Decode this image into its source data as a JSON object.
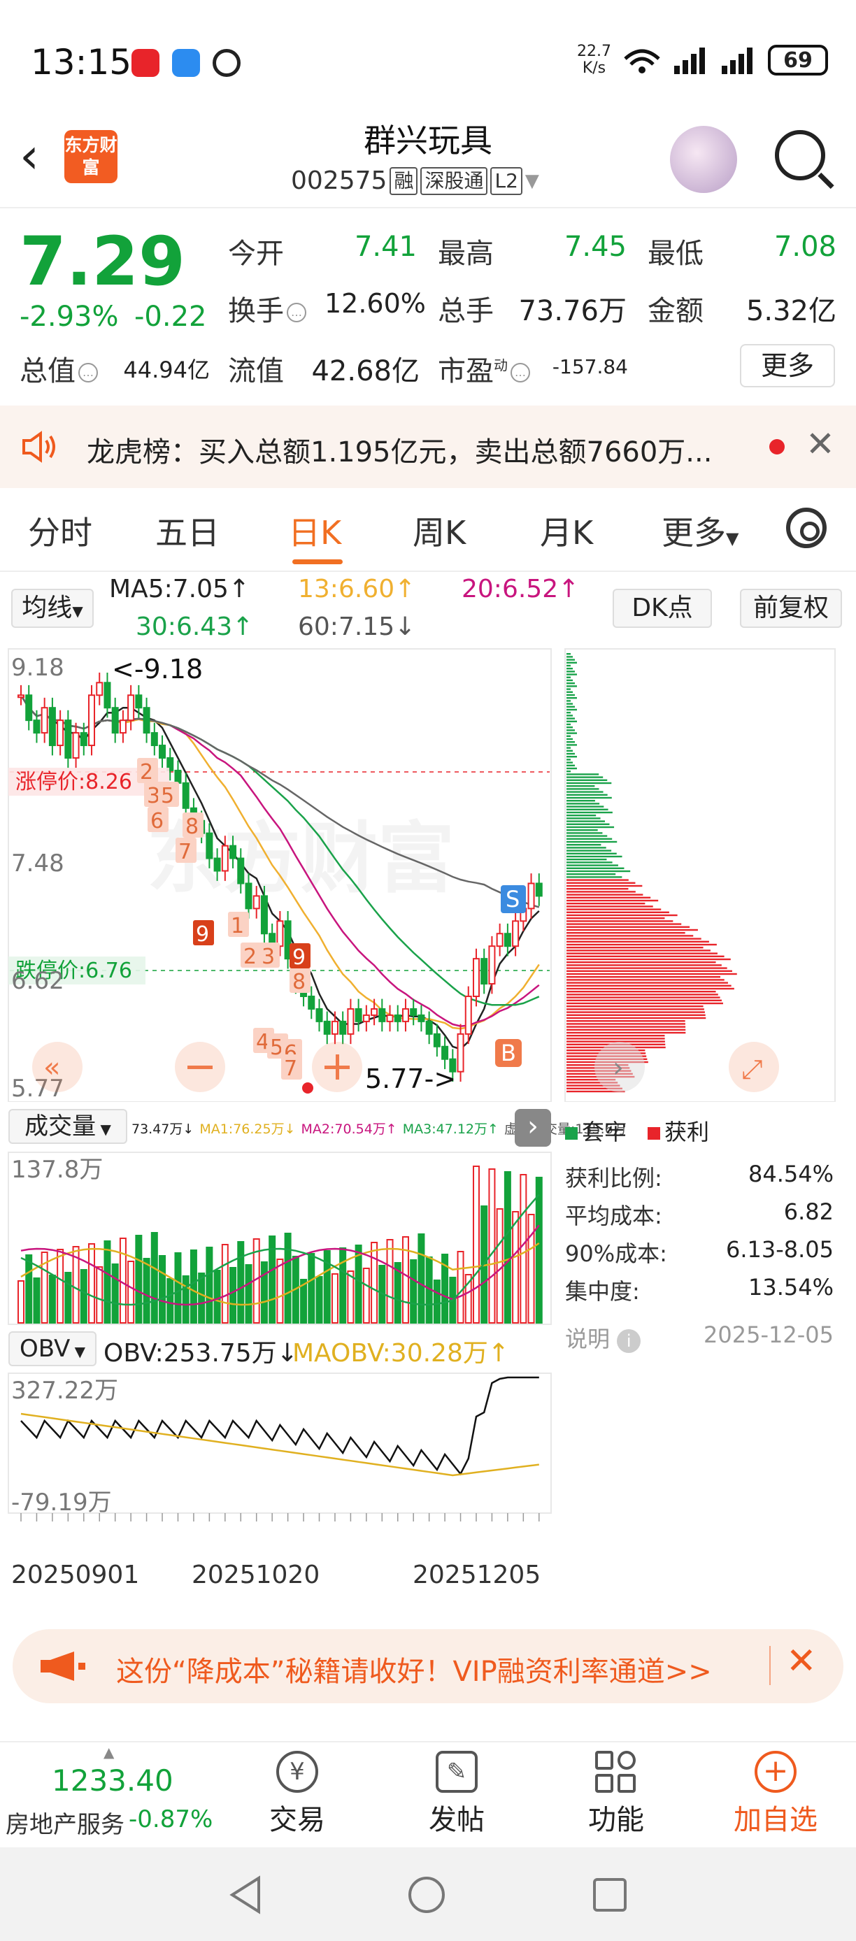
{
  "status_bar": {
    "time": "13:15",
    "net_speed": "22.7",
    "net_unit": "K/s",
    "battery": "69"
  },
  "header": {
    "logo_text": "东方财富",
    "stock_name": "群兴玩具",
    "stock_code": "002575",
    "tag_margin": "融",
    "tag_connect": "深股通",
    "tag_level": "L2"
  },
  "quote": {
    "price": "7.29",
    "change_pct": "-2.93%",
    "change_abs": "-0.22",
    "open_label": "今开",
    "open": "7.41",
    "high_label": "最高",
    "high": "7.45",
    "low_label": "最低",
    "low": "7.08",
    "turnover_label": "换手",
    "turnover": "12.60%",
    "volume_label": "总手",
    "volume": "73.76万",
    "amount_label": "金额",
    "amount": "5.32亿",
    "total_mv_label": "总值",
    "total_mv": "44.94亿",
    "float_mv_label": "流值",
    "float_mv": "42.68亿",
    "pe_label": "市盈",
    "pe_sup": "动",
    "pe": "-157.84",
    "more_label": "更多"
  },
  "lhb": {
    "text": "龙虎榜：买入总额1.195亿元，卖出总额7660万..."
  },
  "tabs": [
    "分时",
    "五日",
    "日K",
    "周K",
    "月K",
    "更多"
  ],
  "active_tab": "日K",
  "indicators": {
    "ma_selector": "均线",
    "ma5": "MA5:7.05↑",
    "ma13": "13:6.60↑",
    "ma20": "20:6.52↑",
    "ma30": "30:6.43↑",
    "ma60": "60:7.15↓",
    "dk_label": "DK点",
    "fq_label": "前复权"
  },
  "kline": {
    "price_top": "9.18",
    "price_mid": "7.48",
    "price_low_axis": "6.62",
    "price_bottom": "5.77",
    "high_mark": "<-9.18",
    "low_mark": "5.77->",
    "limit_up": "涨停价:8.26",
    "limit_down": "跌停价:6.76",
    "sign_s": "S",
    "sign_b": "B",
    "td_marks": [
      "2",
      "3",
      "5",
      "6",
      "8",
      "7",
      "9",
      "1",
      "2",
      "3",
      "8",
      "9",
      "4",
      "5",
      "6",
      "7"
    ],
    "colors": {
      "ma5": "#222222",
      "ma13": "#f0b030",
      "ma20": "#c8157e",
      "ma30": "#1aa24a",
      "ma60": "#666666",
      "up": "#e8242a",
      "down": "#12a23a"
    }
  },
  "volume": {
    "selector": "成交量",
    "legend": [
      "73.47万↓",
      "MA1:76.25万↓",
      "MA2:70.54万↑",
      "MA3:47.12万↑",
      "虚拟成交量:135.6万"
    ],
    "axis_top": "137.8万"
  },
  "obv": {
    "selector": "OBV",
    "obv_value": "OBV:253.75万↓",
    "maobv_value": "MAOBV:30.28万↑",
    "axis_top": "327.22万",
    "axis_bottom": "-79.19万"
  },
  "dates": [
    "20250901",
    "20251020",
    "20251205"
  ],
  "chips": {
    "legend_trapped": "套牢",
    "legend_profit": "获利",
    "rows": [
      {
        "label": "获利比例:",
        "value": "84.54%"
      },
      {
        "label": "平均成本:",
        "value": "6.82"
      },
      {
        "label": "90%成本:",
        "value": "6.13-8.05"
      },
      {
        "label": "集中度:",
        "value": "13.54%"
      }
    ],
    "note_label": "说明",
    "note_date": "2025-12-05"
  },
  "promo": {
    "text": "这份“降成本”秘籍请收好！VIP融资利率通道>>"
  },
  "bottom": {
    "index_value": "1233.40",
    "index_name": "房地产服务",
    "index_change": "-0.87%",
    "items": [
      "交易",
      "发帖",
      "功能",
      "加自选"
    ]
  }
}
